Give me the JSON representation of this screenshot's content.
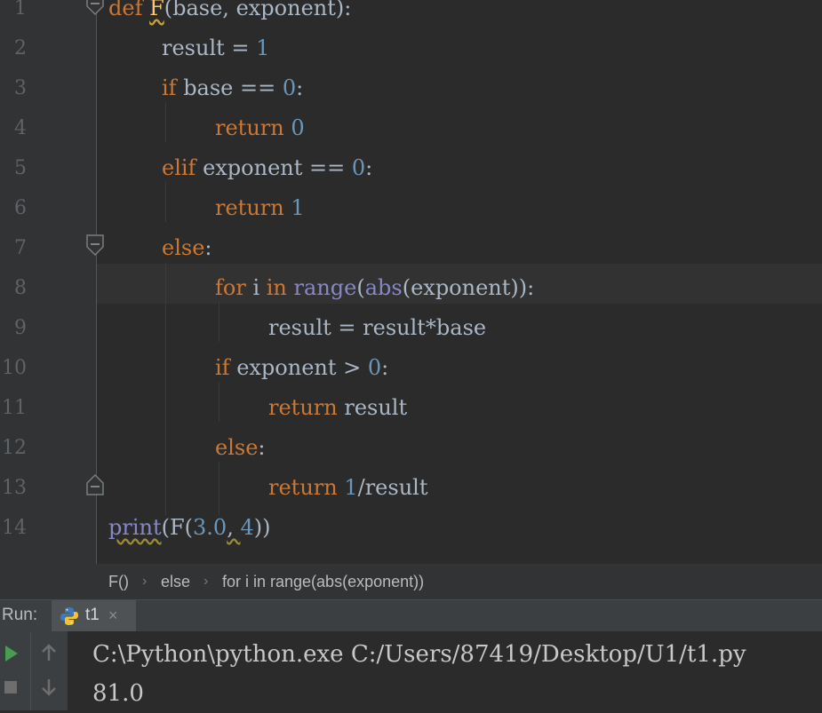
{
  "editor": {
    "line_numbers": [
      "1",
      "2",
      "3",
      "4",
      "5",
      "6",
      "7",
      "8",
      "9",
      "10",
      "11",
      "12",
      "13",
      "14"
    ],
    "code": {
      "l1": {
        "kw": "def",
        "fn": "F",
        "rest": "(base, exponent):"
      },
      "l2": {
        "text": "result = ",
        "num": "1"
      },
      "l3": {
        "kw": "if",
        "text": " base == ",
        "num": "0",
        "tail": ":"
      },
      "l4": {
        "kw": "return",
        "num": " 0"
      },
      "l5": {
        "kw": "elif",
        "text": " exponent == ",
        "num": "0",
        "tail": ":"
      },
      "l6": {
        "kw": "return",
        "num": " 1"
      },
      "l7": {
        "kw": "else",
        "tail": ":"
      },
      "l8": {
        "kw1": "for",
        "t1": " i ",
        "kw2": "in",
        "sp": " ",
        "bi1": "range",
        "t2": "(",
        "bi2": "abs",
        "t3": "(exponent)):"
      },
      "l9": {
        "text": "result = result*base"
      },
      "l10": {
        "kw": "if",
        "text": " exponent > ",
        "num": "0",
        "tail": ":"
      },
      "l11": {
        "kw": "return",
        "text": " result"
      },
      "l12": {
        "kw": "else",
        "tail": ":"
      },
      "l13": {
        "kw": "return",
        "num": " 1",
        "text": "/result"
      },
      "l14": {
        "bi": "print",
        "t1": "(F(",
        "n1": "3.0",
        "t2": ", ",
        "n2": "4",
        "t3": "))"
      }
    }
  },
  "breadcrumb": {
    "items": [
      "F()",
      "else",
      "for i in range(abs(exponent))"
    ],
    "separator": "›"
  },
  "run": {
    "label": "Run:",
    "tab_label": "t1",
    "tab_close": "×",
    "console": [
      "C:\\Python\\python.exe C:/Users/87419/Desktop/U1/t1.py",
      "81.0"
    ]
  },
  "icons": {
    "fold": "fold-marker-icon",
    "python": "python-icon",
    "run": "run-play-icon",
    "stop": "stop-icon",
    "up": "arrow-up-icon",
    "down": "arrow-down-icon"
  },
  "colors": {
    "background": "#2b2b2b",
    "keyword": "#cc7832",
    "number": "#6897bb",
    "builtin": "#8888c6",
    "function": "#ffc66d",
    "text": "#a9b7c6"
  }
}
